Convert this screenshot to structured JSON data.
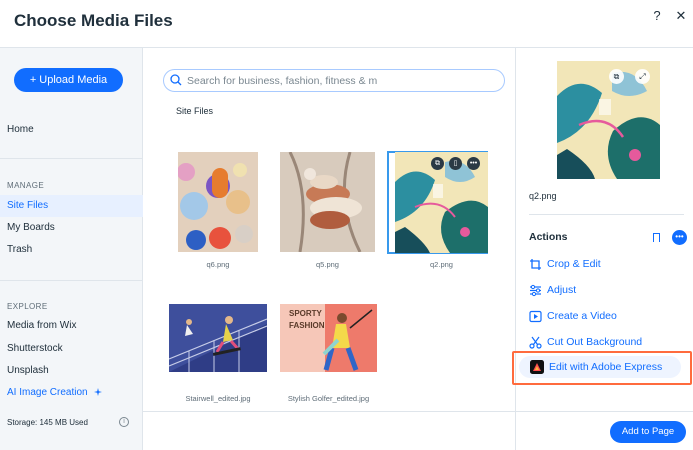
{
  "header": {
    "title": "Choose Media Files",
    "help_label": "?",
    "close_label": "✕"
  },
  "sidebar": {
    "upload_label": "+ Upload Media",
    "home_label": "Home",
    "manage_section": "MANAGE",
    "manage_items": [
      "Site Files",
      "My Boards",
      "Trash"
    ],
    "explore_section": "EXPLORE",
    "explore_items": [
      "Media from Wix",
      "Shutterstock",
      "Unsplash",
      "AI Image Creation"
    ],
    "storage_text": "Storage: 145 MB Used",
    "info_label": "i"
  },
  "main": {
    "search_placeholder": "Search for business, fashion, fitness & m",
    "breadcrumb": "Site Files",
    "files": [
      "q6.png",
      "q5.png",
      "q2.png",
      "Stairwell_edited.jpg",
      "Stylish Golfer_edited.jpg"
    ],
    "golfer_text": "SPORTY\nFASHION"
  },
  "panel": {
    "preview_name": "q2.png",
    "actions_title": "Actions",
    "more_label": "•••",
    "actions": [
      "Crop & Edit",
      "Adjust",
      "Create a Video",
      "Cut Out Background",
      "Edit with Adobe Express"
    ],
    "add_button": "Add to Page"
  },
  "colors": {
    "accent": "#116dff",
    "highlight": "#ff6b3d",
    "sidebar_bg": "#f3f6f9"
  }
}
